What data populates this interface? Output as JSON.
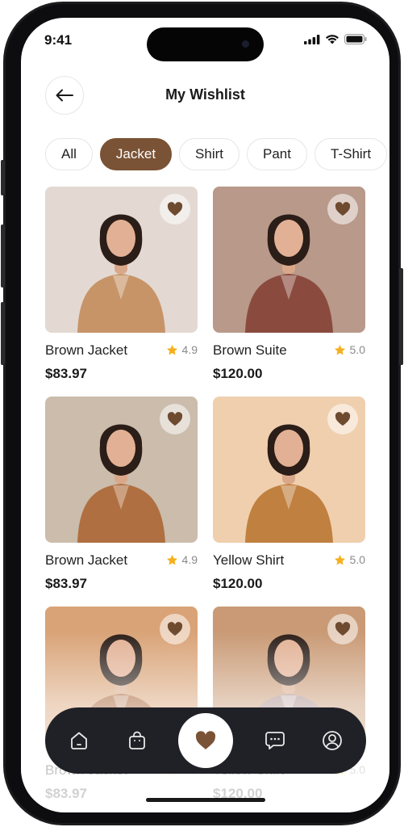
{
  "status_bar": {
    "time": "9:41"
  },
  "header": {
    "title": "My Wishlist"
  },
  "filters": [
    {
      "label": "All",
      "active": false
    },
    {
      "label": "Jacket",
      "active": true
    },
    {
      "label": "Shirt",
      "active": false
    },
    {
      "label": "Pant",
      "active": false
    },
    {
      "label": "T-Shirt",
      "active": false
    }
  ],
  "products": [
    {
      "name": "Brown Jacket",
      "rating": "4.9",
      "price": "$83.97",
      "photo_bg": "#e3d9d2",
      "garment": "#c79468"
    },
    {
      "name": "Brown Suite",
      "rating": "5.0",
      "price": "$120.00",
      "photo_bg": "#b8998a",
      "garment": "#8a4b3e"
    },
    {
      "name": "Brown Jacket",
      "rating": "4.9",
      "price": "$83.97",
      "photo_bg": "#cbbcac",
      "garment": "#b06f40"
    },
    {
      "name": "Yellow Shirt",
      "rating": "5.0",
      "price": "$120.00",
      "photo_bg": "#efcfae",
      "garment": "#c0803f"
    },
    {
      "name": "Brown Jacket",
      "rating": "4.9",
      "price": "$83.97",
      "photo_bg": "#d9a377",
      "garment": "#a45d2c"
    },
    {
      "name": "Yellow Shirt",
      "rating": "5.0",
      "price": "$120.00",
      "photo_bg": "#c99a75",
      "garment": "#a98d8a"
    }
  ],
  "bottom_nav": [
    "home-icon",
    "bag-icon",
    "heart-icon",
    "chat-icon",
    "profile-icon"
  ],
  "colors": {
    "accent": "#7a5235",
    "nav_bg": "#202127",
    "star": "#f6b01e"
  }
}
